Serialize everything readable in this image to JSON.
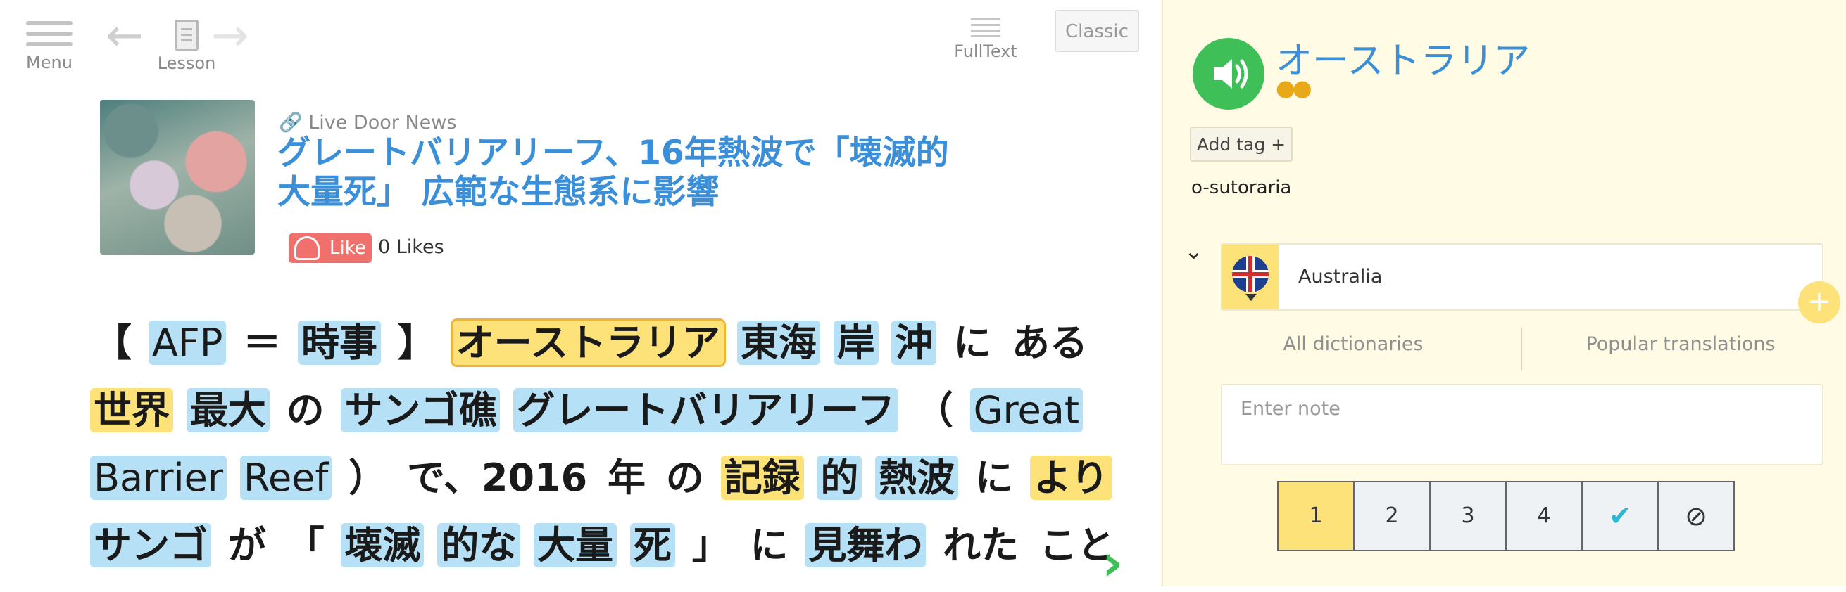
{
  "toolbar": {
    "menu_label": "Menu",
    "lesson_label": "Lesson",
    "fulltext_label": "FullText",
    "classic_label": "Classic"
  },
  "article": {
    "source": "Live Door News",
    "title_line1": "グレートバリアリーフ、16年熱波で「壊滅的",
    "title_line2": "大量死」 広範な生態系に影響",
    "like_label": "Like",
    "likes_count": "0 Likes"
  },
  "body": {
    "lines": [
      [
        {
          "t": "【",
          "s": "p"
        },
        {
          "t": "AFP",
          "s": "b"
        },
        {
          "t": "＝",
          "s": "p"
        },
        {
          "t": "時事",
          "s": "b"
        },
        {
          "t": "】",
          "s": "p"
        },
        {
          "t": "オーストラリア",
          "s": "sel"
        },
        {
          "t": "東海",
          "s": "b"
        },
        {
          "t": "岸",
          "s": "b"
        },
        {
          "t": "沖",
          "s": "b"
        },
        {
          "t": "に",
          "s": "p"
        },
        {
          "t": "ある",
          "s": "p"
        }
      ],
      [
        {
          "t": "世界",
          "s": "y"
        },
        {
          "t": "最大",
          "s": "b"
        },
        {
          "t": "の",
          "s": "p"
        },
        {
          "t": "サンゴ礁",
          "s": "b"
        },
        {
          "t": "グレートバリアリーフ",
          "s": "b"
        },
        {
          "t": "（",
          "s": "p"
        },
        {
          "t": "Great",
          "s": "b"
        }
      ],
      [
        {
          "t": "Barrier",
          "s": "b"
        },
        {
          "t": "Reef",
          "s": "b"
        },
        {
          "t": "）",
          "s": "p"
        },
        {
          "t": "で、2016",
          "s": "p"
        },
        {
          "t": "年",
          "s": "p"
        },
        {
          "t": "の",
          "s": "p"
        },
        {
          "t": "記録",
          "s": "y"
        },
        {
          "t": "的",
          "s": "b"
        },
        {
          "t": "熱波",
          "s": "b"
        },
        {
          "t": "に",
          "s": "p"
        },
        {
          "t": "より",
          "s": "y"
        }
      ],
      [
        {
          "t": "サンゴ",
          "s": "b"
        },
        {
          "t": "が",
          "s": "p"
        },
        {
          "t": "「",
          "s": "p"
        },
        {
          "t": "壊滅",
          "s": "b"
        },
        {
          "t": "的な",
          "s": "b"
        },
        {
          "t": "大量",
          "s": "b"
        },
        {
          "t": "死",
          "s": "b"
        },
        {
          "t": "」",
          "s": "p"
        },
        {
          "t": "に",
          "s": "p"
        },
        {
          "t": "見舞わ",
          "s": "b"
        },
        {
          "t": "れた",
          "s": "p"
        },
        {
          "t": "こと",
          "s": "p"
        }
      ]
    ]
  },
  "panel": {
    "word": "オーストラリア",
    "coins": "●●",
    "add_tag_label": "Add tag +",
    "romaji": "o-sutoraria",
    "translation": "Australia",
    "plus_label": "+",
    "tab_all": "All dictionaries",
    "tab_popular": "Popular translations",
    "note_placeholder": "Enter note",
    "levels": [
      "1",
      "2",
      "3",
      "4",
      "✔",
      "⊘"
    ],
    "active_level": "1"
  },
  "icons": {
    "menu": "hamburger-icon",
    "prev": "arrow-left-icon",
    "next": "arrow-right-icon",
    "lesson": "document-icon",
    "fulltext": "text-lines-icon",
    "audio": "speaker-icon",
    "flag": "uk-flag-icon",
    "next_page": "chevron-right-icon"
  },
  "colors": {
    "accent_blue": "#3b8fd9",
    "known_blue": "#b6e0f5",
    "learning_yellow": "#fde27a",
    "audio_green": "#3fbf58",
    "panel_bg": "#fffbe5",
    "like_red": "#f0706e"
  }
}
